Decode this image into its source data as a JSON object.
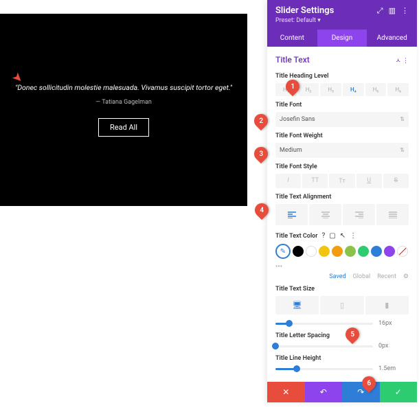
{
  "preview": {
    "quote": "\"Donec sollicitudin molestie malesuada. Vivamus suscipit tortor eget.\"",
    "author": "— Tatiana Gagelman",
    "button": "Read All"
  },
  "header": {
    "title": "Slider Settings",
    "preset": "Preset: Default ▾"
  },
  "tabs": [
    "Content",
    "Design",
    "Advanced"
  ],
  "section": "Title Text",
  "labels": {
    "heading": "Title Heading Level",
    "font": "Title Font",
    "weight": "Title Font Weight",
    "style": "Title Font Style",
    "align": "Title Text Alignment",
    "color": "Title Text Color",
    "size": "Title Text Size",
    "spacing": "Title Letter Spacing",
    "lineheight": "Title Line Height"
  },
  "headingLevels": [
    "H₁",
    "H₂",
    "H₃",
    "H₄",
    "H₅",
    "H₆"
  ],
  "font": "Josefin Sans",
  "weight": "Medium",
  "styles": [
    "I",
    "TT",
    "Tᴛ",
    "U",
    "S"
  ],
  "savedTabs": [
    "Saved",
    "Global",
    "Recent"
  ],
  "values": {
    "size": "16px",
    "spacing": "0px",
    "lineheight": "1.5em"
  },
  "colors": {
    "black": "#000",
    "yellow": "#f1c40f",
    "orange": "#f39c12",
    "green": "#2ecc71",
    "lime": "#27ae60",
    "blue": "#2e7dd6",
    "purple": "#8e44ec"
  },
  "markers": [
    "1",
    "2",
    "3",
    "4",
    "5",
    "6"
  ]
}
